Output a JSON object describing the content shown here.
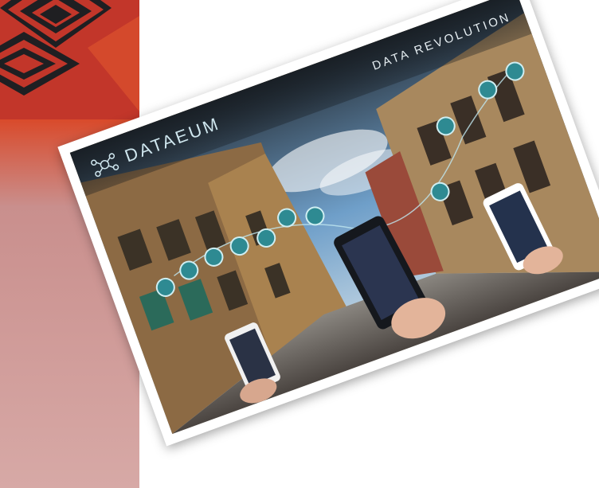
{
  "photo": {
    "brand": "DATAEUM",
    "tagline": "DATA REVOLUTION"
  },
  "icons": [
    "social-icon",
    "megaphone-icon",
    "chart-icon",
    "tools-icon",
    "building-icon",
    "car-icon",
    "cloud-icon",
    "location-icon",
    "chart-icon",
    "money-icon",
    "wrench-icon",
    "pin-icon"
  ]
}
